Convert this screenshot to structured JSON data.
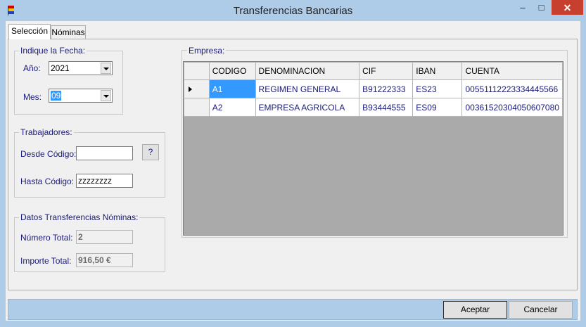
{
  "window": {
    "title": "Transferencias Bancarias",
    "minimize_glyph": "–",
    "maximize_glyph": "□",
    "close_glyph": "✕",
    "icon": "app-flag-icon"
  },
  "tabs": [
    {
      "label": "Selección",
      "active": true
    },
    {
      "label": "Nóminas",
      "active": false
    }
  ],
  "fecha": {
    "legend": "Indique  la Fecha:",
    "anio_label": "Año:",
    "anio_value": "2021",
    "mes_label": "Mes:",
    "mes_value": "09"
  },
  "trabajadores": {
    "legend": "Trabajadores:",
    "desde_label": "Desde Código:",
    "desde_value": "",
    "lookup_button": "?",
    "hasta_label": "Hasta Código:",
    "hasta_value": "zzzzzzzz"
  },
  "datos": {
    "legend": "Datos Transferencias Nóminas:",
    "numero_label": "Número Total:",
    "numero_value": "2",
    "importe_label": "Importe Total:",
    "importe_value": "916,50 €"
  },
  "empresa": {
    "legend": "Empresa:",
    "columns": [
      "CODIGO",
      "DENOMINACION",
      "CIF",
      "IBAN",
      "CUENTA"
    ],
    "rows": [
      {
        "codigo": "A1",
        "denominacion": "REGIMEN GENERAL",
        "cif": "B91222333",
        "iban": "ES23",
        "cuenta": "00551112223334445566"
      },
      {
        "codigo": "A2",
        "denominacion": "EMPRESA AGRICOLA",
        "cif": "B93444555",
        "iban": "ES09",
        "cuenta": "00361520304050607080"
      }
    ]
  },
  "buttons": {
    "aceptar": "Aceptar",
    "cancelar": "Cancelar"
  },
  "colors": {
    "titlebar": "#aecbe8",
    "close": "#c7402f",
    "selection": "#3399ff",
    "label_text": "#1a1a7a"
  }
}
